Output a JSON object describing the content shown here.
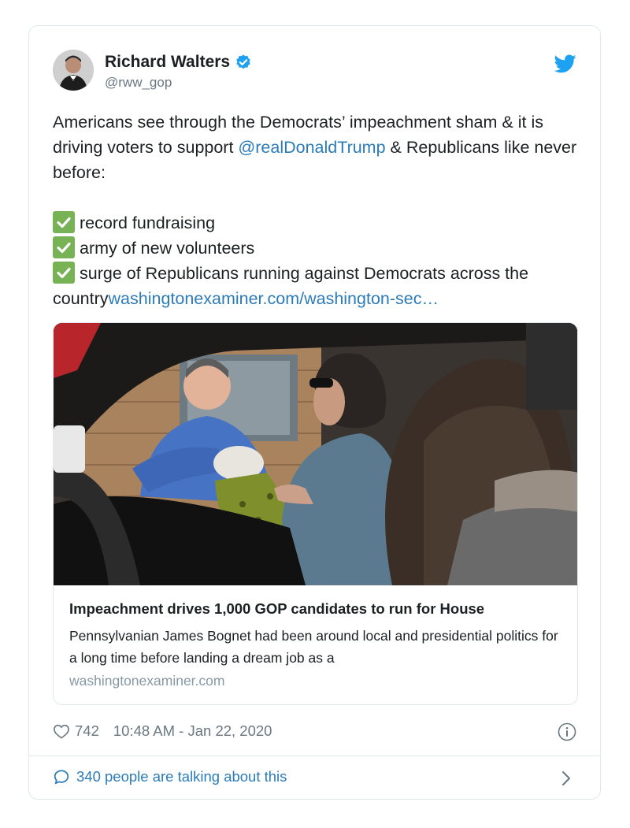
{
  "tweet": {
    "author_name": "Richard Walters",
    "author_handle": "@rww_gop",
    "text_intro": "Americans see through the Democrats’ impeachment sham & it is driving voters to support ",
    "mention": "@realDonaldTrump",
    "text_after_mention": " & Republicans like never before:",
    "checklist": [
      "record fundraising",
      "army of new volunteers",
      "surge of Republicans running against Democrats across the"
    ],
    "checklist_tail": "country",
    "link": "washingtonexaminer.com/washington-sec…",
    "likes": "742",
    "timestamp": "10:48 AM - Jan 22, 2020",
    "talking": "340 people are talking about this"
  },
  "preview": {
    "title": "Impeachment drives 1,000 GOP candidates to run for House",
    "description": "Pennsylvanian James Bognet had been around local and presidential politics for a long time before landing a dream job as a",
    "domain": "washingtonexaminer.com"
  },
  "icons": {
    "verified": "verified-badge-icon",
    "bird": "twitter-bird-icon",
    "heart": "heart-icon",
    "info": "info-icon",
    "comment": "speech-bubble-icon",
    "chevron": "chevron-right-icon",
    "check": "check-mark-icon"
  },
  "colors": {
    "link": "#2b7bb9",
    "verified": "#1da1f2",
    "check_green": "#77b255",
    "muted": "#697882"
  }
}
